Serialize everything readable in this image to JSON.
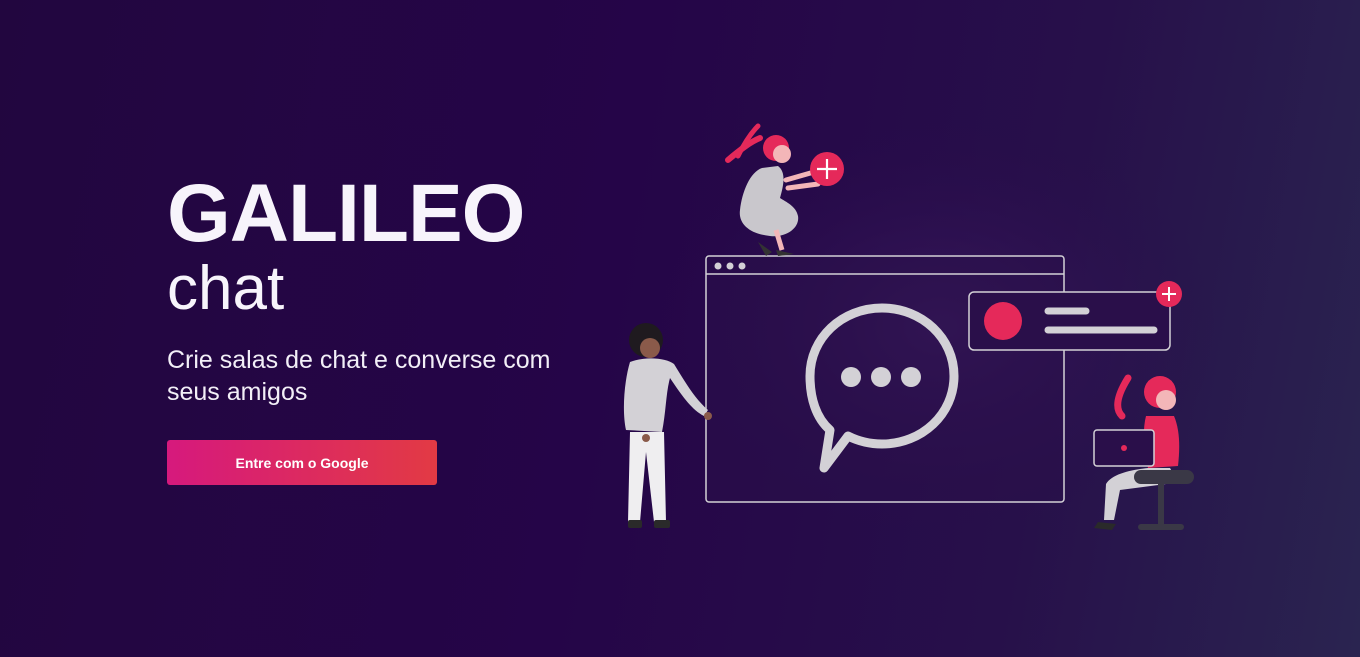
{
  "hero": {
    "title": "GALILEO",
    "subtitle": "chat",
    "tagline": "Crie salas de chat e converse com seus amigos",
    "cta_label": "Entre com o Google"
  },
  "colors": {
    "background": "#240545",
    "accent_pink": "#e5295a",
    "button_start": "#d6197d",
    "button_end": "#e23a44",
    "text": "#f7f4fb",
    "illustration_gray": "#d3d1d6"
  },
  "illustration": {
    "icons": [
      "chat-bubble-icon",
      "plus-icon",
      "laptop-icon",
      "browser-window"
    ]
  }
}
